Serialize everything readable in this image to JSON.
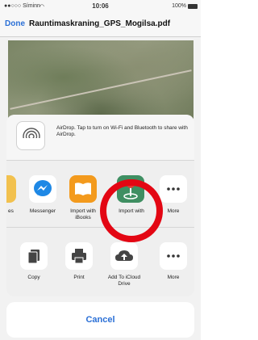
{
  "status": {
    "carrier": "●●○○○ Síminn",
    "time": "10:06",
    "battery": "100%"
  },
  "nav": {
    "done": "Done",
    "title": "Rauntimaskraning_GPS_Mogilsa.pdf"
  },
  "airdrop": {
    "text": "AirDrop. Tap to turn on Wi-Fi and Bluetooth to share with AirDrop."
  },
  "apps": [
    {
      "label": "es",
      "icon": "partial-app-icon"
    },
    {
      "label": "Messenger",
      "icon": "messenger-icon"
    },
    {
      "label": "Import with iBooks",
      "icon": "ibooks-icon"
    },
    {
      "label": "Import with",
      "icon": "map-pin-icon"
    },
    {
      "label": "More",
      "icon": "more-icon"
    }
  ],
  "actions": [
    {
      "label": "Copy",
      "icon": "copy-icon"
    },
    {
      "label": "Print",
      "icon": "print-icon"
    },
    {
      "label": "Add To iCloud Drive",
      "icon": "icloud-upload-icon"
    },
    {
      "label": "More",
      "icon": "more-icon"
    }
  ],
  "cancel": "Cancel",
  "colors": {
    "accent": "#2a6fd6",
    "highlight": "#e30613"
  }
}
